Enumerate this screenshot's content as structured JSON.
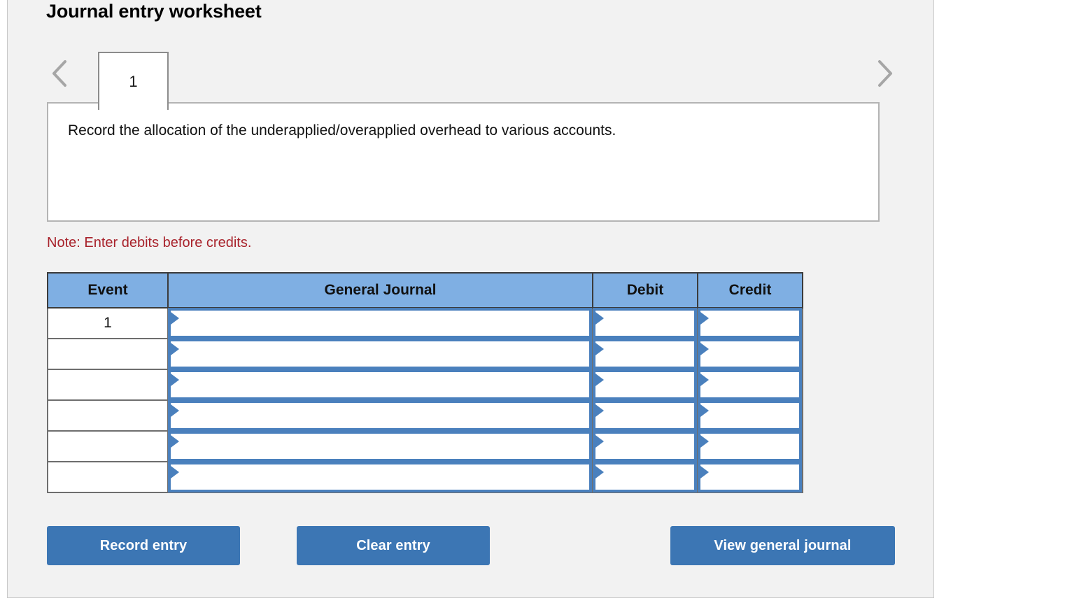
{
  "worksheet": {
    "title": "Journal entry worksheet",
    "tabs": [
      {
        "label": "1"
      }
    ],
    "nav": {
      "prev_icon": "chevron-left-icon",
      "next_icon": "chevron-right-icon"
    },
    "question_text": "Record the allocation of the underapplied/overapplied overhead to various accounts.",
    "note": "Note: Enter debits before credits.",
    "table": {
      "headers": [
        "Event",
        "General Journal",
        "Debit",
        "Credit"
      ],
      "rows": [
        {
          "event": "1",
          "general_journal": "",
          "debit": "",
          "credit": ""
        },
        {
          "event": "",
          "general_journal": "",
          "debit": "",
          "credit": ""
        },
        {
          "event": "",
          "general_journal": "",
          "debit": "",
          "credit": ""
        },
        {
          "event": "",
          "general_journal": "",
          "debit": "",
          "credit": ""
        },
        {
          "event": "",
          "general_journal": "",
          "debit": "",
          "credit": ""
        },
        {
          "event": "",
          "general_journal": "",
          "debit": "",
          "credit": ""
        }
      ]
    },
    "buttons": {
      "record": "Record entry",
      "clear": "Clear entry",
      "view": "View general journal"
    },
    "colors": {
      "panel_background": "#f2f2f2",
      "header_blue": "#7fafe3",
      "button_blue": "#3c76b4",
      "note_red": "#a8222b",
      "input_border_blue": "#4a80bd"
    }
  }
}
